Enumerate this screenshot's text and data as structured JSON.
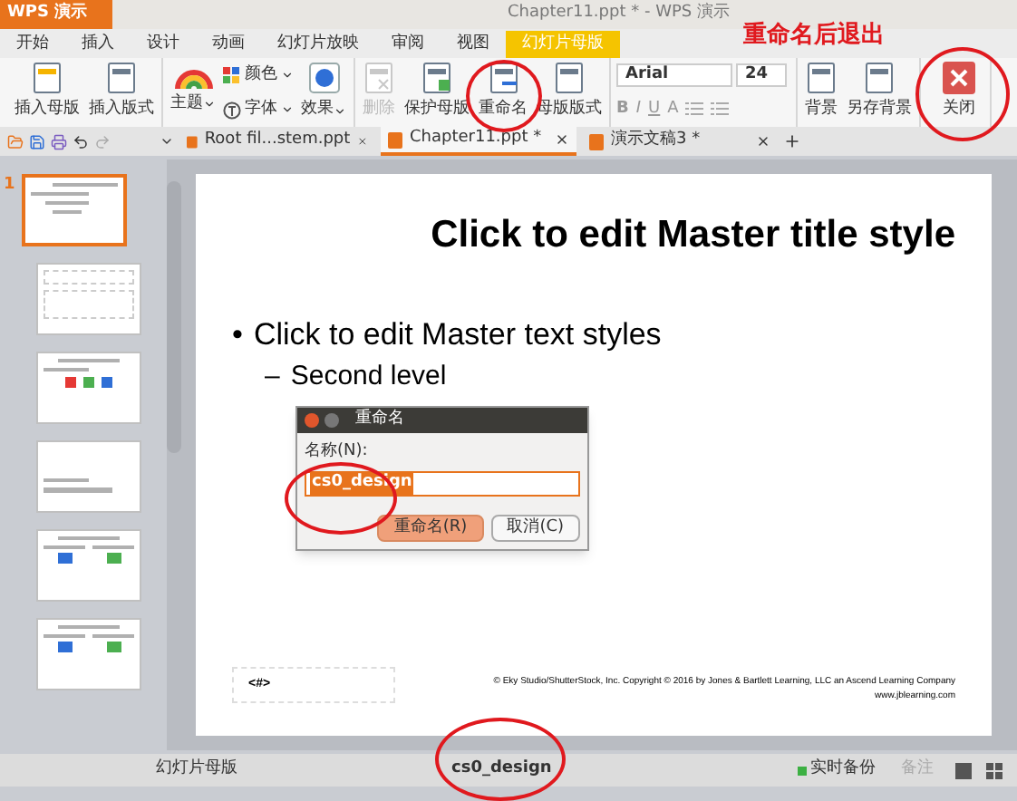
{
  "app_button": {
    "label": "WPS 演示"
  },
  "window": {
    "title": "Chapter11.ppt * - WPS 演示"
  },
  "menu_tabs": [
    {
      "label": "开始",
      "selected": false
    },
    {
      "label": "插入",
      "selected": false
    },
    {
      "label": "设计",
      "selected": false
    },
    {
      "label": "动画",
      "selected": false
    },
    {
      "label": "幻灯片放映",
      "selected": false
    },
    {
      "label": "审阅",
      "selected": false
    },
    {
      "label": "视图",
      "selected": false
    },
    {
      "label": "幻灯片母版",
      "selected": true
    }
  ],
  "annotation": "重命名后退出",
  "ribbon": {
    "groups": [
      {
        "items": [
          {
            "kind": "large",
            "label": "插入母版",
            "disabled": false
          },
          {
            "kind": "large",
            "label": "插入版式",
            "disabled": false
          }
        ]
      },
      {
        "items": [
          {
            "kind": "large_menu",
            "label": "主题",
            "disabled": false
          },
          {
            "kind": "pair",
            "top": "颜色",
            "bottom": "字体"
          },
          {
            "kind": "large_menu",
            "label": "效果",
            "disabled": false
          }
        ]
      },
      {
        "items": [
          {
            "kind": "large",
            "label": "删除",
            "disabled": true
          },
          {
            "kind": "large",
            "label": "保护母版",
            "disabled": false
          },
          {
            "kind": "large",
            "label": "重命名",
            "disabled": false
          },
          {
            "kind": "large",
            "label": "母版版式",
            "disabled": false
          }
        ]
      },
      {
        "items": [
          {
            "kind": "font",
            "font": "Arial",
            "size": "24",
            "formats": [
              "B",
              "I",
              "U",
              "A"
            ]
          }
        ]
      },
      {
        "items": [
          {
            "kind": "large",
            "label": "背景",
            "disabled": false
          },
          {
            "kind": "large",
            "label": "另存背景",
            "disabled": false
          }
        ]
      },
      {
        "items": [
          {
            "kind": "close",
            "label": "关闭",
            "disabled": false
          }
        ]
      }
    ]
  },
  "doc_tabs": [
    {
      "label": "Root fil...stem.ppt",
      "selected": false
    },
    {
      "label": "Chapter11.ppt *",
      "selected": true
    },
    {
      "label": "演示文稿3 *",
      "selected": false
    }
  ],
  "slides": [
    {
      "number": "1",
      "kind": "title_content",
      "selected": true
    },
    {
      "kind": "blank",
      "selected": false
    },
    {
      "kind": "chart",
      "selected": false
    },
    {
      "kind": "section",
      "selected": false
    },
    {
      "kind": "two_content",
      "selected": false
    },
    {
      "kind": "two_content",
      "selected": false
    }
  ],
  "slide": {
    "title": "Click to edit Master title style",
    "bullets": [
      {
        "marker": "•",
        "text": "Click to edit Master text styles",
        "children": [
          {
            "marker": "–",
            "text": "Second level"
          }
        ]
      }
    ],
    "number_field": "<#>",
    "copyright": "© Eky Studio/ShutterStock, Inc. Copyright © 2016 by Jones & Bartlett Learning, LLC an Ascend Learning Company",
    "website": "www.jblearning.com"
  },
  "dialog": {
    "title": "重命名",
    "field_label": "名称(N):",
    "value": "cs0_design",
    "buttons": [
      {
        "label": "重命名(R)",
        "primary": true
      },
      {
        "label": "取消(C)",
        "primary": false
      }
    ]
  },
  "status_bar": {
    "view": "幻灯片母版",
    "design": "cs0_design",
    "backup": "实时备份",
    "notes": "备注"
  }
}
